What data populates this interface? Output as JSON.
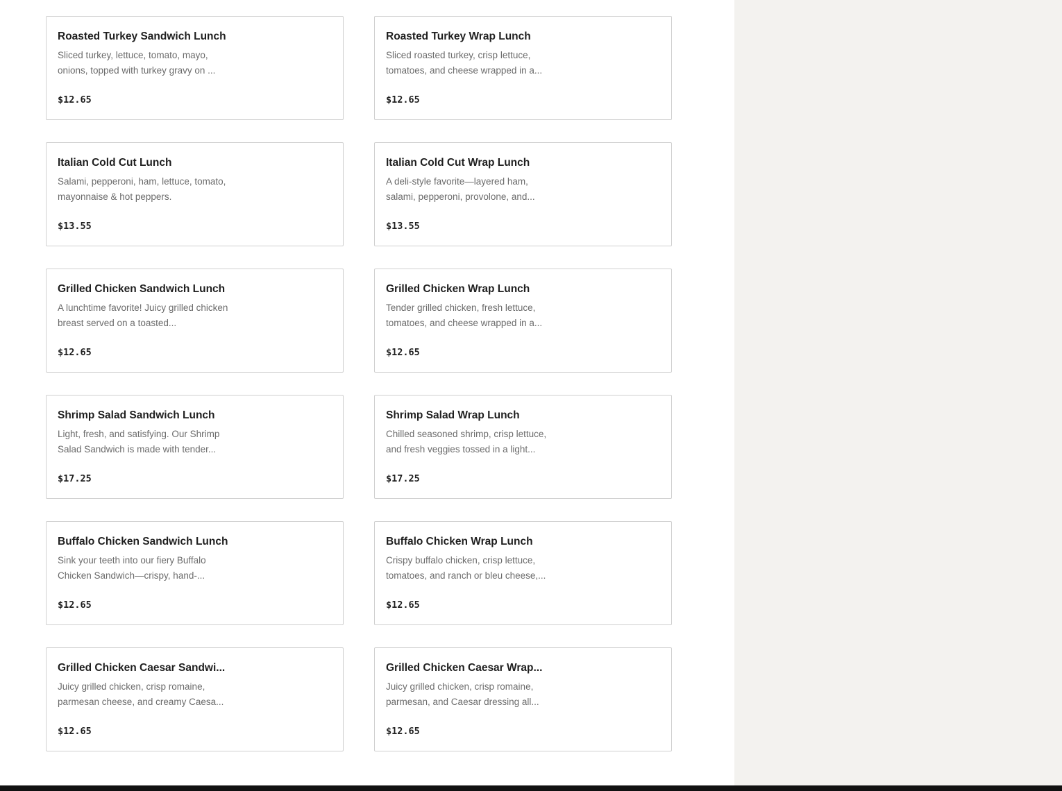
{
  "menu_items": [
    {
      "title": "Roasted Turkey Sandwich Lunch",
      "description": "Sliced turkey, lettuce, tomato, mayo, onions, topped with turkey gravy on ...",
      "price": "$12.65"
    },
    {
      "title": "Roasted Turkey Wrap Lunch",
      "description": "Sliced roasted turkey, crisp lettuce, tomatoes, and cheese wrapped in a...",
      "price": "$12.65"
    },
    {
      "title": "Italian Cold Cut Lunch",
      "description": "Salami, pepperoni, ham, lettuce, tomato, mayonnaise & hot peppers.",
      "price": "$13.55"
    },
    {
      "title": "Italian Cold Cut Wrap Lunch",
      "description": "A deli-style favorite—layered ham, salami, pepperoni, provolone, and...",
      "price": "$13.55"
    },
    {
      "title": "Grilled Chicken Sandwich Lunch",
      "description": "A lunchtime favorite! Juicy grilled chicken breast served on a toasted...",
      "price": "$12.65"
    },
    {
      "title": "Grilled Chicken Wrap Lunch",
      "description": "Tender grilled chicken, fresh lettuce, tomatoes, and cheese wrapped in a...",
      "price": "$12.65"
    },
    {
      "title": "Shrimp Salad Sandwich Lunch",
      "description": "Light, fresh, and satisfying. Our Shrimp Salad Sandwich is made with tender...",
      "price": "$17.25"
    },
    {
      "title": "Shrimp Salad Wrap Lunch",
      "description": "Chilled seasoned shrimp, crisp lettuce, and fresh veggies tossed in a light...",
      "price": "$17.25"
    },
    {
      "title": "Buffalo Chicken Sandwich Lunch",
      "description": "Sink your teeth into our fiery Buffalo Chicken Sandwich—crispy, hand-...",
      "price": "$12.65"
    },
    {
      "title": "Buffalo Chicken Wrap Lunch",
      "description": "Crispy buffalo chicken, crisp lettuce, tomatoes, and ranch or bleu cheese,...",
      "price": "$12.65"
    },
    {
      "title": "Grilled Chicken Caesar Sandwi...",
      "description": "Juicy grilled chicken, crisp romaine, parmesan cheese, and creamy Caesa...",
      "price": "$12.65"
    },
    {
      "title": "Grilled Chicken Caesar Wrap...",
      "description": "Juicy grilled chicken, crisp romaine, parmesan, and Caesar dressing all...",
      "price": "$12.65"
    }
  ]
}
